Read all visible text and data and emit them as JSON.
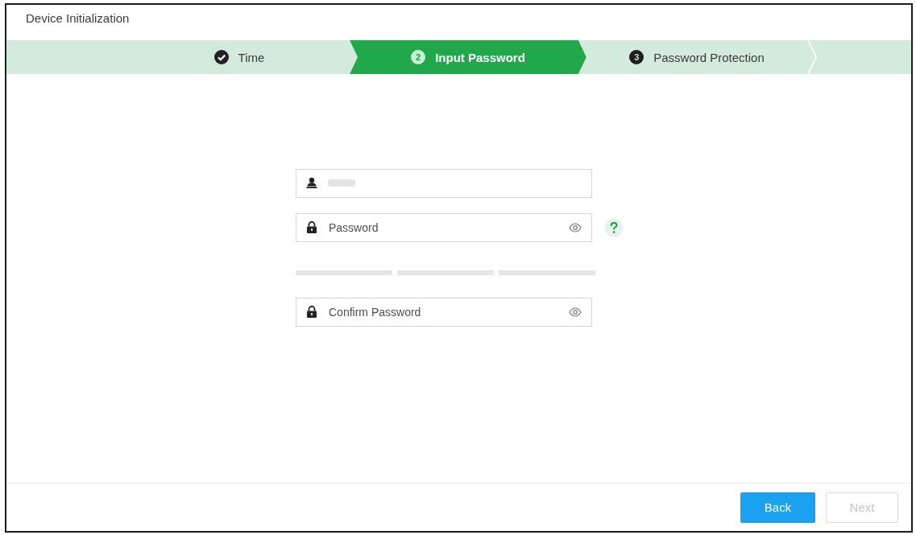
{
  "window": {
    "title": "Device Initialization"
  },
  "steps": [
    {
      "label": "Time",
      "done": true,
      "selected": false
    },
    {
      "number": "2",
      "label": "Input Password",
      "done": false,
      "selected": true
    },
    {
      "number": "3",
      "label": "Password Protection",
      "done": false,
      "selected": false
    }
  ],
  "fields": [
    {
      "kind": "user",
      "redacted": true,
      "help": false
    },
    {
      "kind": "password",
      "placeholder": "Password",
      "help": true,
      "strength": {
        "level": 0
      }
    },
    {
      "kind": "password",
      "placeholder": "Confirm Password",
      "help": false
    }
  ],
  "buttons": [
    {
      "label": "Back",
      "disabled": false
    },
    {
      "label": "Next",
      "disabled": true
    }
  ]
}
